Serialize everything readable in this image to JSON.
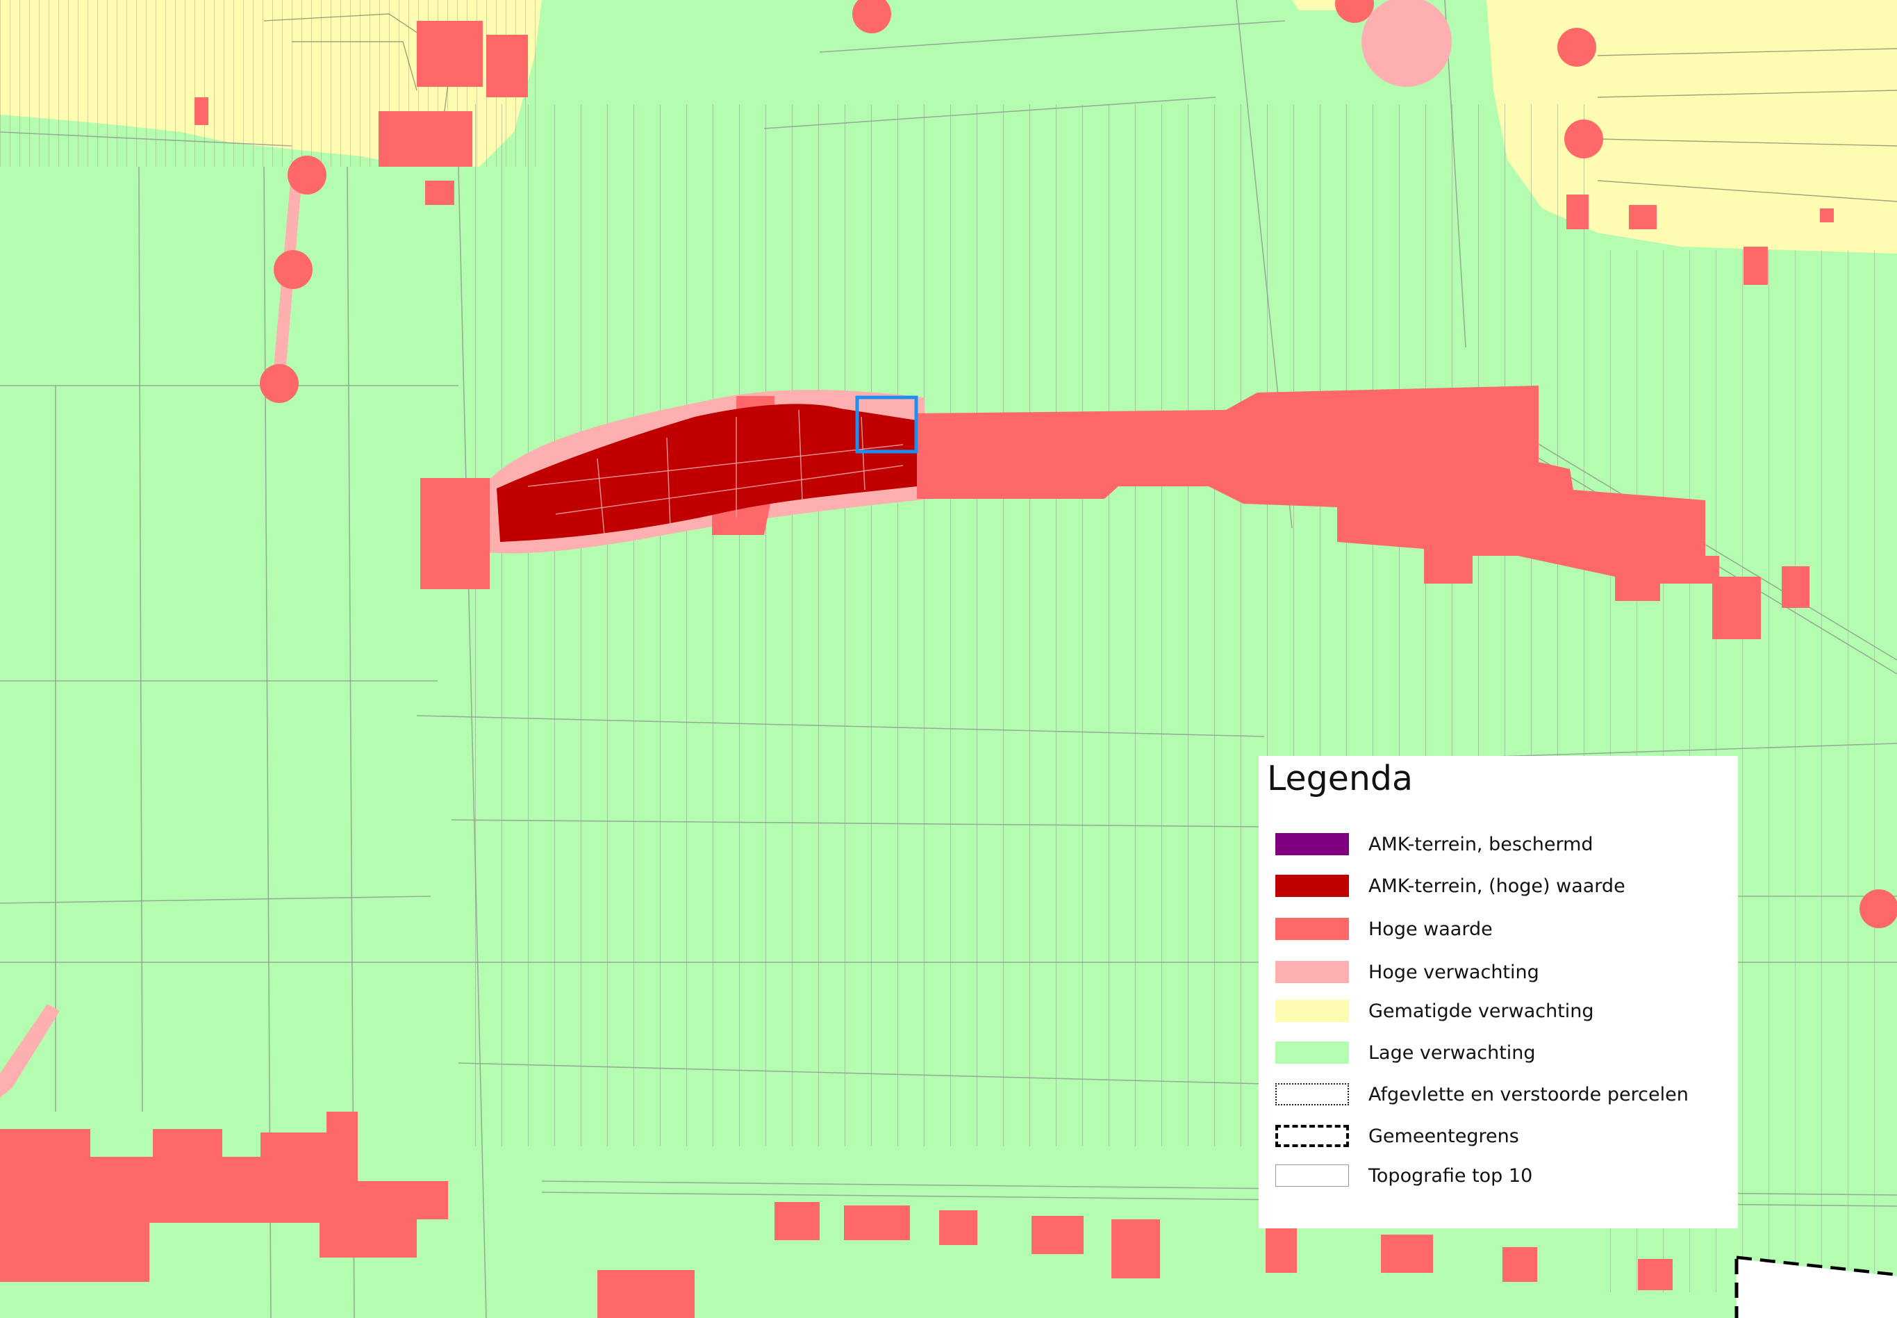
{
  "colors": {
    "background": "#b4fdb0",
    "amk_beschermd": "#800080",
    "amk_hoge_waarde": "#c00000",
    "hoge_waarde": "#fe6868",
    "hoge_verwachting": "#feb0b0",
    "gematigde_verwachting": "#fefcb0",
    "lage_verwachting": "#b4fdb0",
    "parcel_lines": "#8f9a8f",
    "highlight": "#1e8ff0"
  },
  "legend": {
    "title": "Legenda",
    "items": [
      {
        "label": "AMK-terrein, beschermd",
        "swatch": "#800080",
        "style": "fill"
      },
      {
        "label": "AMK-terrein, (hoge) waarde",
        "swatch": "#c00000",
        "style": "fill"
      },
      {
        "label": "Hoge waarde",
        "swatch": "#fe6868",
        "style": "fill"
      },
      {
        "label": "Hoge verwachting",
        "swatch": "#feb0b0",
        "style": "fill"
      },
      {
        "label": "Gematigde verwachting",
        "swatch": "#fefcb0",
        "style": "fill"
      },
      {
        "label": "Lage verwachting",
        "swatch": "#b4fdb0",
        "style": "fill"
      },
      {
        "label": "Afgevlette en verstoorde percelen",
        "swatch": "#ffffff",
        "style": "hatched"
      },
      {
        "label": "Gemeentegrens",
        "swatch": "#ffffff",
        "style": "dashed"
      },
      {
        "label": "Topografie top 10",
        "swatch": "#ffffff",
        "style": "outline"
      }
    ]
  }
}
